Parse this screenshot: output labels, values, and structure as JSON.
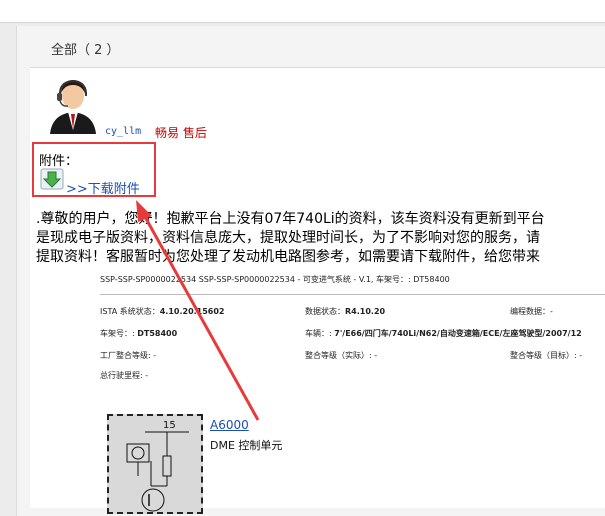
{
  "tab": {
    "label": "全部（ 2 ）"
  },
  "post": {
    "username": "cy_llm",
    "role": "畅易 售后",
    "attachment_label": "附件：",
    "download_link": ">>下载附件",
    "paragraph_lines": [
      ".尊敬的用户，您好！抱歉平台上没有07年740Li的资料，该车资料没有更新到平台",
      "是现成电子版资料，资料信息庞大，提取处理时间长，为了不影响对您的服务，请",
      "提取资料！客服暂时为您处理了发动机电路图参考，如需要请下载附件，给您带来"
    ]
  },
  "doc": {
    "header": "SSP-SSP-SP0000022534 SSP-SSP-SP0000022534 - 可变进气系统 - V.1, 车架号：: DT58400",
    "ista_label": "ISTA 系统状态：",
    "ista_value": "4.10.20.15602",
    "data_status_label": "数据状态：",
    "data_status_value": "R4.10.20",
    "programming_label": "编程数据：-",
    "vin_label": "车架号：:",
    "vin_value": "DT58400",
    "vehicle_label": "车辆：:",
    "vehicle_value": "7'/E66/四门车/740Li/N62/自动变速箱/ECE/左座驾驶型/2007/12",
    "factory_label": "工厂整合等级: -",
    "integration_actual": "整合等级（实际）: -",
    "integration_target": "整合等级（目标）: -",
    "mileage": "总行驶里程: -",
    "component_id": "A6000",
    "component_name": "DME 控制单元",
    "pin": "15"
  },
  "colors": {
    "highlight_box": "#e83a3a",
    "link": "#1a4fb5",
    "role": "#cc0000"
  }
}
